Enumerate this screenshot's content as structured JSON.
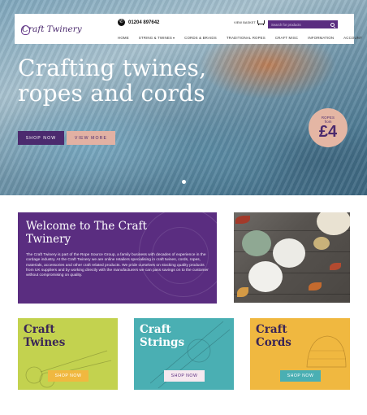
{
  "header": {
    "logo_text": "Craft Twinery",
    "phone": "01204 897642",
    "basket_label": "VIEW BASKET",
    "search_placeholder": "Search for products",
    "nav": [
      {
        "label": "HOME",
        "has_dropdown": false
      },
      {
        "label": "STRING & TWINES",
        "has_dropdown": true
      },
      {
        "label": "CORDS & BRAIDS",
        "has_dropdown": false
      },
      {
        "label": "TRADITIONAL ROPES",
        "has_dropdown": false
      },
      {
        "label": "CRAFT MISC",
        "has_dropdown": false
      },
      {
        "label": "INFORMATION",
        "has_dropdown": false
      },
      {
        "label": "ACCOUNT",
        "has_dropdown": false
      }
    ]
  },
  "hero": {
    "title": "Crafting twines, ropes and cords",
    "shop_now": "SHOP NOW",
    "view_more": "VIEW MORE",
    "badge": {
      "label": "ROPES",
      "from": "from",
      "price": "£4"
    },
    "slide_count": 1
  },
  "welcome": {
    "title": "Welcome to The Craft Twinery",
    "text": "The Craft Twinery is part of the Rope Source Group, a family business with decades of experience in the cordage industry. At the Craft Twinery we are online retailers specialising in craft twines, cords, ropes, materials, accessories and other craft related products. We pride ourselves on stocking quality products from UK suppliers and by working directly with the manufacturers we can pass savings on to the customer without compromising on quality."
  },
  "categories": [
    {
      "title": "Craft Twines",
      "button": "SHOP NOW"
    },
    {
      "title": "Craft Strings",
      "button": "SHOP NOW"
    },
    {
      "title": "Craft Cords",
      "button": "SHOP NOW"
    }
  ],
  "colors": {
    "brand_purple": "#5a2d80",
    "accent_pink": "#e2b1a3",
    "lime": "#c3d24f",
    "teal": "#4aafb3",
    "mustard": "#f0b840"
  }
}
